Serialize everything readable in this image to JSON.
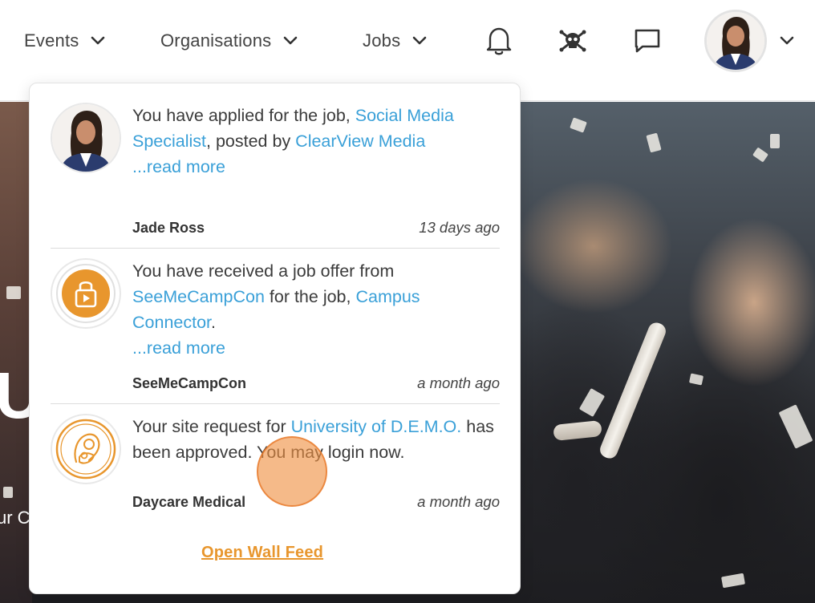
{
  "nav": {
    "events_label": "Events",
    "organisations_label": "Organisations",
    "jobs_label": "Jobs"
  },
  "icons": {
    "bell": "bell-icon",
    "pirate": "skull-crossbones-icon",
    "chat": "chat-icon",
    "chevron": "chevron-down-icon"
  },
  "hero": {
    "big_text": "Ur",
    "small_text": "ur C"
  },
  "notifications": [
    {
      "prefix": "You have applied for the job, ",
      "link1": "Social Media Specialist",
      "middle": ", posted by ",
      "link2": "ClearView Media",
      "read_more": "...read more",
      "sender": "Jade Ross",
      "time": "13 days ago"
    },
    {
      "prefix": "You have received a job offer from ",
      "link1": "SeeMeCampCon",
      "middle": " for the job, ",
      "link2": "Campus Connector",
      "suffix": ".",
      "read_more": "...read more",
      "sender": "SeeMeCampCon",
      "time": "a month ago"
    },
    {
      "prefix": "Your site request for ",
      "link1": "University of D.E.M.O.",
      "suffix": " has been approved. You may login now.",
      "sender": "Daycare Medical",
      "time": "a month ago"
    }
  ],
  "footer": {
    "wall_feed_label": "Open Wall Feed"
  },
  "colors": {
    "link": "#3aa0d8",
    "accent_orange": "#e8962d"
  }
}
